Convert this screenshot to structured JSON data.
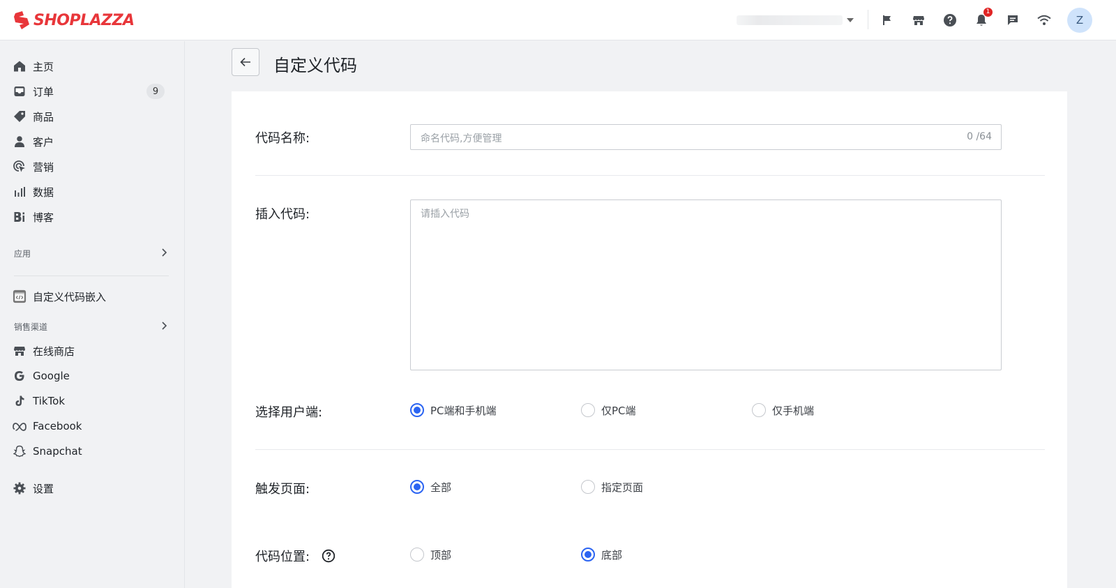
{
  "brand": {
    "name": "SHOPLAZZA",
    "color": "#e8363a"
  },
  "header": {
    "store_selector": "",
    "icons": [
      "flag-icon",
      "store-icon",
      "help-icon",
      "bell-icon",
      "chat-icon",
      "wifi-icon"
    ],
    "notification_count": "1",
    "avatar_initial": "Z"
  },
  "sidebar": {
    "items": [
      {
        "label": "主页",
        "icon": "home-icon"
      },
      {
        "label": "订单",
        "icon": "inbox-icon",
        "count": "9"
      },
      {
        "label": "商品",
        "icon": "tag-icon"
      },
      {
        "label": "客户",
        "icon": "person-icon"
      },
      {
        "label": "营销",
        "icon": "cursor-icon"
      },
      {
        "label": "数据",
        "icon": "bar-chart-icon"
      },
      {
        "label": "博客",
        "icon": "blog-icon"
      }
    ],
    "apps_section": "应用",
    "apps": [
      {
        "label": "自定义代码嵌入",
        "icon": "code-embed-icon"
      }
    ],
    "channels_section": "销售渠道",
    "channels": [
      {
        "label": "在线商店",
        "icon": "store-icon"
      },
      {
        "label": "Google",
        "icon": "google-icon"
      },
      {
        "label": "TikTok",
        "icon": "tiktok-icon"
      },
      {
        "label": "Facebook",
        "icon": "meta-icon"
      },
      {
        "label": "Snapchat",
        "icon": "snapchat-icon"
      }
    ],
    "settings": {
      "label": "设置",
      "icon": "gear-icon"
    }
  },
  "page": {
    "title": "自定义代码",
    "code_name": {
      "label": "代码名称:",
      "placeholder": "命名代码,方便管理",
      "counter": "0 /64"
    },
    "insert_code": {
      "label": "插入代码:",
      "placeholder": "请插入代码"
    },
    "client": {
      "label": "选择用户端:",
      "options": [
        "PC端和手机端",
        "仅PC端",
        "仅手机端"
      ],
      "selected": 0
    },
    "trigger": {
      "label": "触发页面:",
      "options": [
        "全部",
        "指定页面"
      ],
      "selected": 0
    },
    "position": {
      "label": "代码位置:",
      "options": [
        "顶部",
        "底部"
      ],
      "selected": 1
    }
  },
  "colors": {
    "accent": "#2b64f2",
    "badge": "#e02424"
  }
}
